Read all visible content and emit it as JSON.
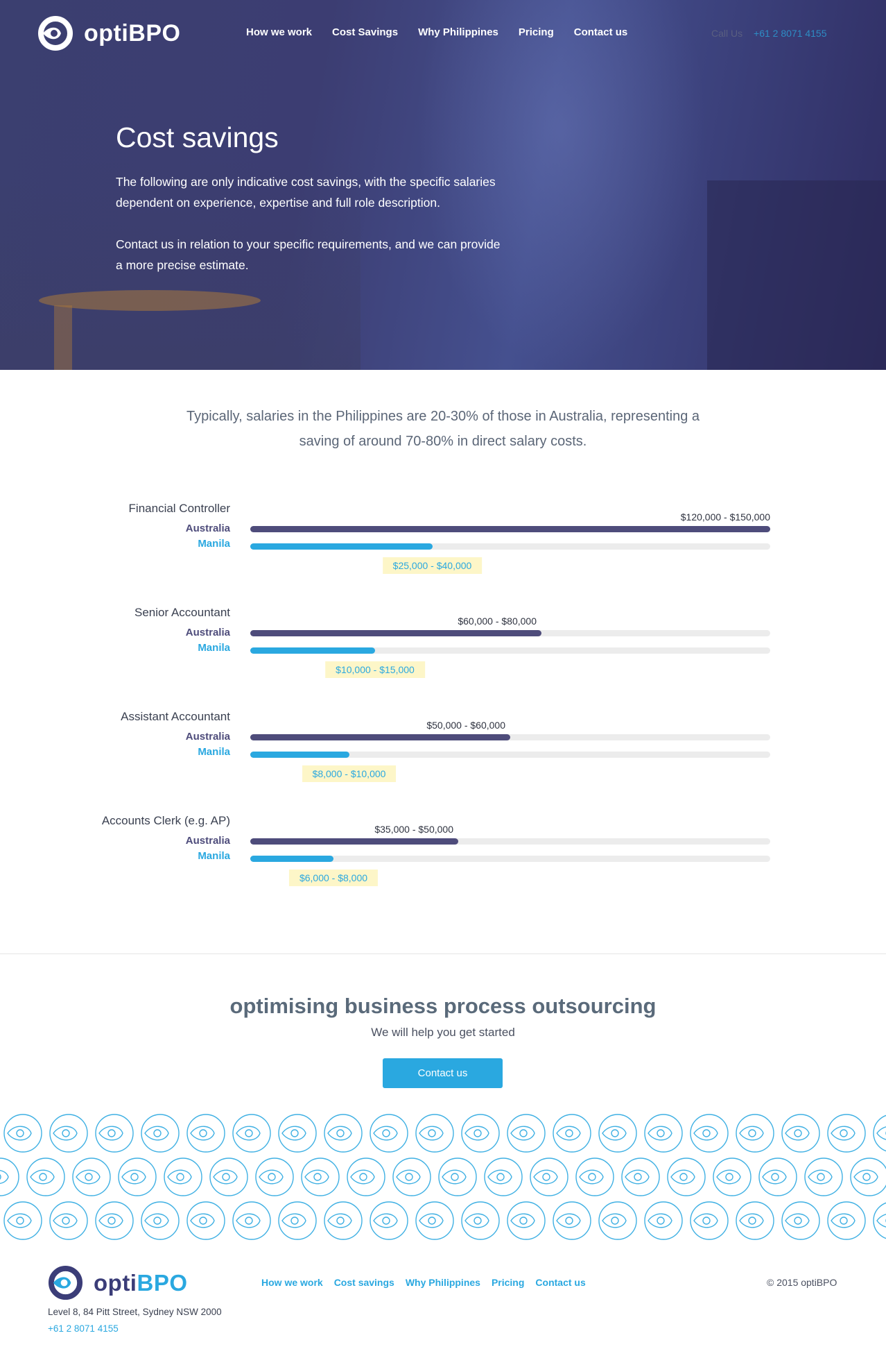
{
  "brand": {
    "name": "optiBPO",
    "name_prefix": "opti",
    "name_suffix": "BPO"
  },
  "nav": {
    "items": [
      "How we work",
      "Cost Savings",
      "Why Philippines",
      "Pricing",
      "Contact us"
    ]
  },
  "call": {
    "label": "Call Us",
    "phone": "+61 2 8071 4155"
  },
  "hero": {
    "title": "Cost savings",
    "paragraph_1": "The following are only indicative cost savings, with the specific salaries dependent on experience, expertise and full role description.",
    "paragraph_2": "Contact us in relation to your specific requirements, and we can provide a more precise estimate."
  },
  "intro": "Typically, salaries in the Philippines are 20-30% of those in Australia, representing a saving of around 70-80% in direct salary costs.",
  "chart_data": {
    "type": "bar",
    "orientation": "horizontal",
    "categories": [
      "Financial Controller",
      "Senior Accountant",
      "Assistant Accountant",
      "Accounts Clerk (e.g. AP)"
    ],
    "series": [
      {
        "name": "Australia",
        "color": "#4e4c7b",
        "fill_percent": [
          100,
          56,
          50,
          40
        ],
        "labels": [
          "$120,000 - $150,000",
          "$60,000 - $80,000",
          "$50,000 - $60,000",
          "$35,000 - $50,000"
        ]
      },
      {
        "name": "Manila",
        "color": "#2aa8e0",
        "fill_percent": [
          35,
          24,
          19,
          16
        ],
        "labels": [
          "$25,000 - $40,000",
          "$10,000 - $15,000",
          "$8,000 - $10,000",
          "$6,000 - $8,000"
        ]
      }
    ]
  },
  "cta": {
    "title": "optimising business process outsourcing",
    "subtitle": "We will help you get started",
    "button": "Contact us"
  },
  "footer": {
    "address": "Level 8, 84 Pitt Street, Sydney NSW 2000",
    "phone": "+61 2 8071 4155",
    "nav": [
      "How we work",
      "Cost savings",
      "Why Philippines",
      "Pricing",
      "Contact us"
    ],
    "copyright": "© 2015 optiBPO"
  },
  "colors": {
    "accent": "#2aa8e0",
    "navy": "#4e4c7b",
    "tag_bg": "#fdf6c8",
    "track": "#ececec"
  },
  "icons": {
    "logo": "optibpo-logo-icon"
  }
}
